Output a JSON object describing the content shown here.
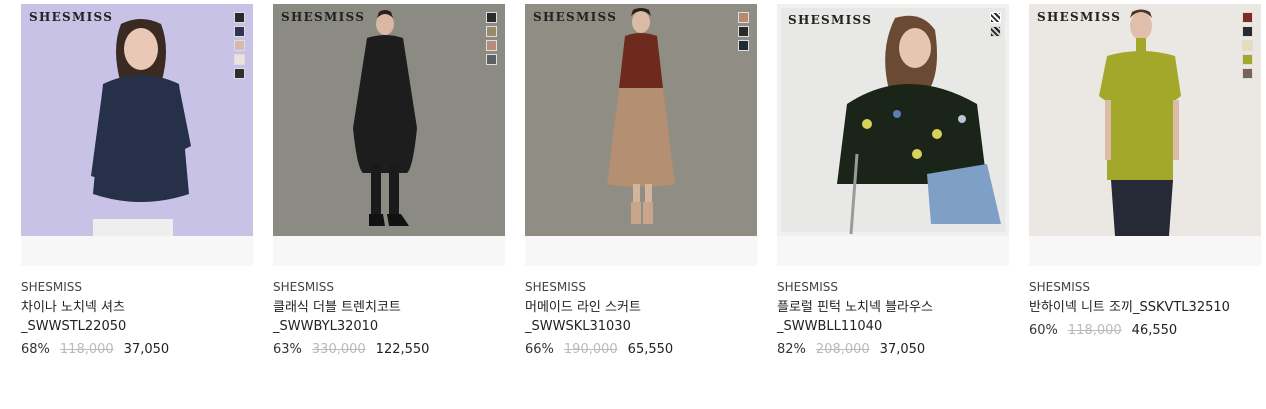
{
  "products": [
    {
      "watermark": "SHESMISS",
      "brand": "SHESMISS",
      "name": "차이나 노치넥 셔츠\n_SWWSTL22050",
      "discount": "68%",
      "original_price": "118,000",
      "price": "37,050",
      "bg": "#c8c2e6",
      "swatches": [
        "#2a2a2a",
        "#2d3550",
        "#d9b9ae",
        "#eae4de",
        "#2f2f2f"
      ]
    },
    {
      "watermark": "SHESMISS",
      "brand": "SHESMISS",
      "name": "클래식 더블 트렌치코트\n_SWWBYL32010",
      "discount": "63%",
      "original_price": "330,000",
      "price": "122,550",
      "bg": "#8b8b84",
      "swatches": [
        "#2a2a2a",
        "#9a8b6a",
        "#b88a78",
        "#5d5f63"
      ]
    },
    {
      "watermark": "SHESMISS",
      "brand": "SHESMISS",
      "name": "머메이드 라인 스커트\n_SWWSKL31030",
      "discount": "66%",
      "original_price": "190,000",
      "price": "65,550",
      "bg": "#8f8d84",
      "swatches": [
        "#b88a6c",
        "#2a2a2a",
        "#1f2b36"
      ]
    },
    {
      "watermark": "SHESMISS",
      "brand": "SHESMISS",
      "name": "플로럴 핀턱 노치넥 블라우스\n_SWWBLL11040",
      "discount": "82%",
      "original_price": "208,000",
      "price": "37,050",
      "bg": "#e8e8e6",
      "swatches": [
        "print",
        "print"
      ]
    },
    {
      "watermark": "SHESMISS",
      "brand": "SHESMISS",
      "name": "반하이넥 니트 조끼_SSKVTL32510",
      "discount": "60%",
      "original_price": "118,000",
      "price": "46,550",
      "bg": "#ebe8e3",
      "swatches": [
        "#7a2f22",
        "#2a2a2a",
        "#e5dcb8",
        "#a3a82b",
        "#7a6458"
      ]
    }
  ]
}
